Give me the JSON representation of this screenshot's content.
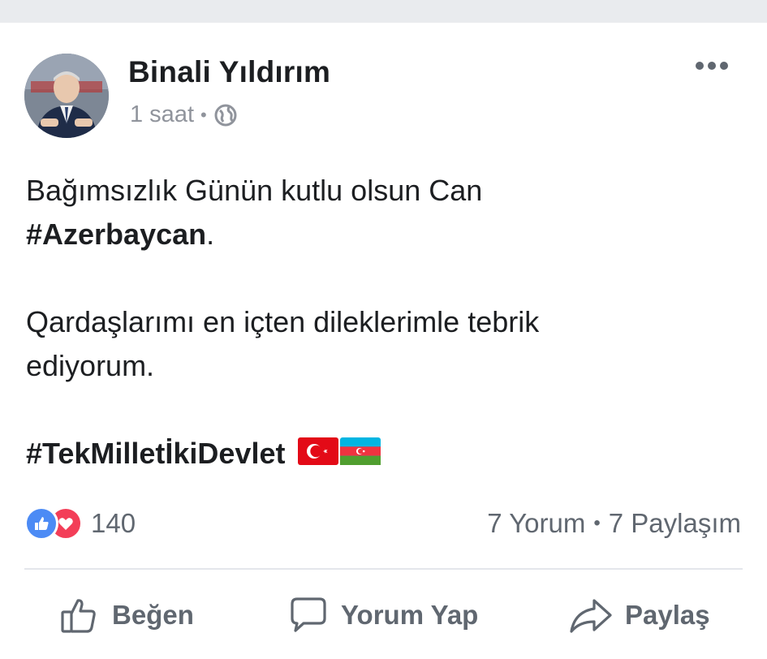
{
  "post": {
    "author": "Binali Yıldırım",
    "time": "1 saat",
    "meta_separator": "•",
    "privacy_icon": "globe-icon",
    "more_icon": "more-dots-icon",
    "text": {
      "line1": "Bağımsızlık Günün kutlu olsun Can",
      "hashtag1": "#Azerbaycan",
      "hashtag1_suffix": ".",
      "paragraph2": "Qardaşlarımı en içten dileklerimle tebrik ediyorum.",
      "hashtag2": "#TekMilletİkiDevlet",
      "flags": [
        "turkey-flag-emoji",
        "azerbaijan-flag-emoji"
      ]
    }
  },
  "reactions": {
    "icons": [
      "like-reaction-icon",
      "love-reaction-icon"
    ],
    "count": "140",
    "comments": "7 Yorum",
    "separator": "•",
    "shares": "7 Paylaşım"
  },
  "actions": {
    "like_label": "Beğen",
    "comment_label": "Yorum Yap",
    "share_label": "Paylaş"
  },
  "colors": {
    "top_bar": "#e9ebee",
    "text": "#1c1e21",
    "secondary_text": "#606770",
    "meta_text": "#90949c",
    "like_blue": "#4c8bf5",
    "love_red": "#f33e58",
    "flag_red": "#e30a17",
    "az_blue": "#00b5e2",
    "az_red": "#ef3340",
    "az_green": "#509e2f"
  }
}
